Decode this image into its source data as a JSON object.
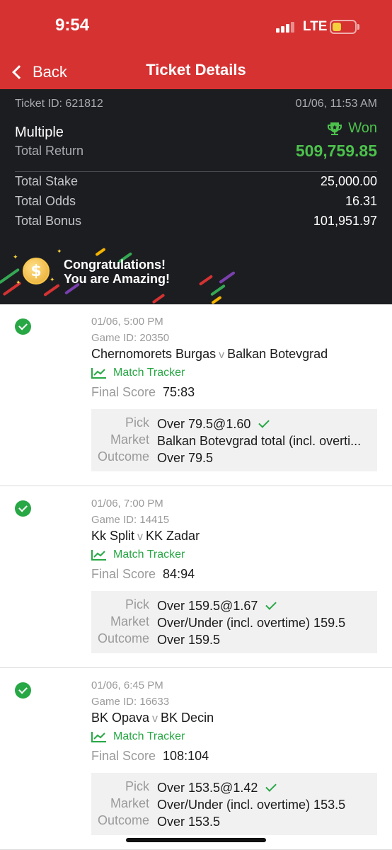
{
  "status_bar": {
    "time": "9:54",
    "network": "LTE"
  },
  "nav": {
    "back_label": "Back",
    "title": "Ticket Details"
  },
  "ticket": {
    "id_label": "Ticket ID: 621812",
    "datetime": "01/06, 11:53 AM",
    "bet_type": "Multiple",
    "status": "Won",
    "total_return_label": "Total Return",
    "total_return": "509,759.85",
    "stats": [
      {
        "label": "Total Stake",
        "value": "25,000.00"
      },
      {
        "label": "Total Odds",
        "value": "16.31"
      },
      {
        "label": "Total Bonus",
        "value": "101,951.97"
      }
    ]
  },
  "banner": {
    "line1": "Congratulations!",
    "line2": "You are Amazing!",
    "coin_symbol": "$"
  },
  "events": [
    {
      "time": "01/06, 5:00 PM",
      "game_id": "Game ID: 20350",
      "home": "Chernomorets Burgas",
      "vs": "v",
      "away": "Balkan Botevgrad",
      "tracker_label": "Match Tracker",
      "final_label": "Final Score",
      "final_score": "75:83",
      "pick_label": "Pick",
      "pick": "Over 79.5@1.60",
      "market_label": "Market",
      "market": "Balkan Botevgrad total (incl. overti...",
      "outcome_label": "Outcome",
      "outcome": "Over 79.5"
    },
    {
      "time": "01/06, 7:00 PM",
      "game_id": "Game ID: 14415",
      "home": "Kk Split",
      "vs": "v",
      "away": "KK Zadar",
      "tracker_label": "Match Tracker",
      "final_label": "Final Score",
      "final_score": "84:94",
      "pick_label": "Pick",
      "pick": "Over 159.5@1.67",
      "market_label": "Market",
      "market": "Over/Under (incl. overtime) 159.5",
      "outcome_label": "Outcome",
      "outcome": "Over 159.5"
    },
    {
      "time": "01/06, 6:45 PM",
      "game_id": "Game ID: 16633",
      "home": "BK Opava",
      "vs": "v",
      "away": "BK Decin",
      "tracker_label": "Match Tracker",
      "final_label": "Final Score",
      "final_score": "108:104",
      "pick_label": "Pick",
      "pick": "Over 153.5@1.42",
      "market_label": "Market",
      "market": "Over/Under (incl. overtime) 153.5",
      "outcome_label": "Outcome",
      "outcome": "Over 153.5"
    }
  ],
  "colors": {
    "brand_red": "#d63232",
    "win_green": "#4cc24c",
    "check_green": "#28a745",
    "dark_bg": "#1c1d21"
  },
  "icons": {
    "back": "chevron-left-icon",
    "won": "trophy-icon",
    "tracker": "line-chart-icon",
    "settled": "check-circle-icon"
  }
}
